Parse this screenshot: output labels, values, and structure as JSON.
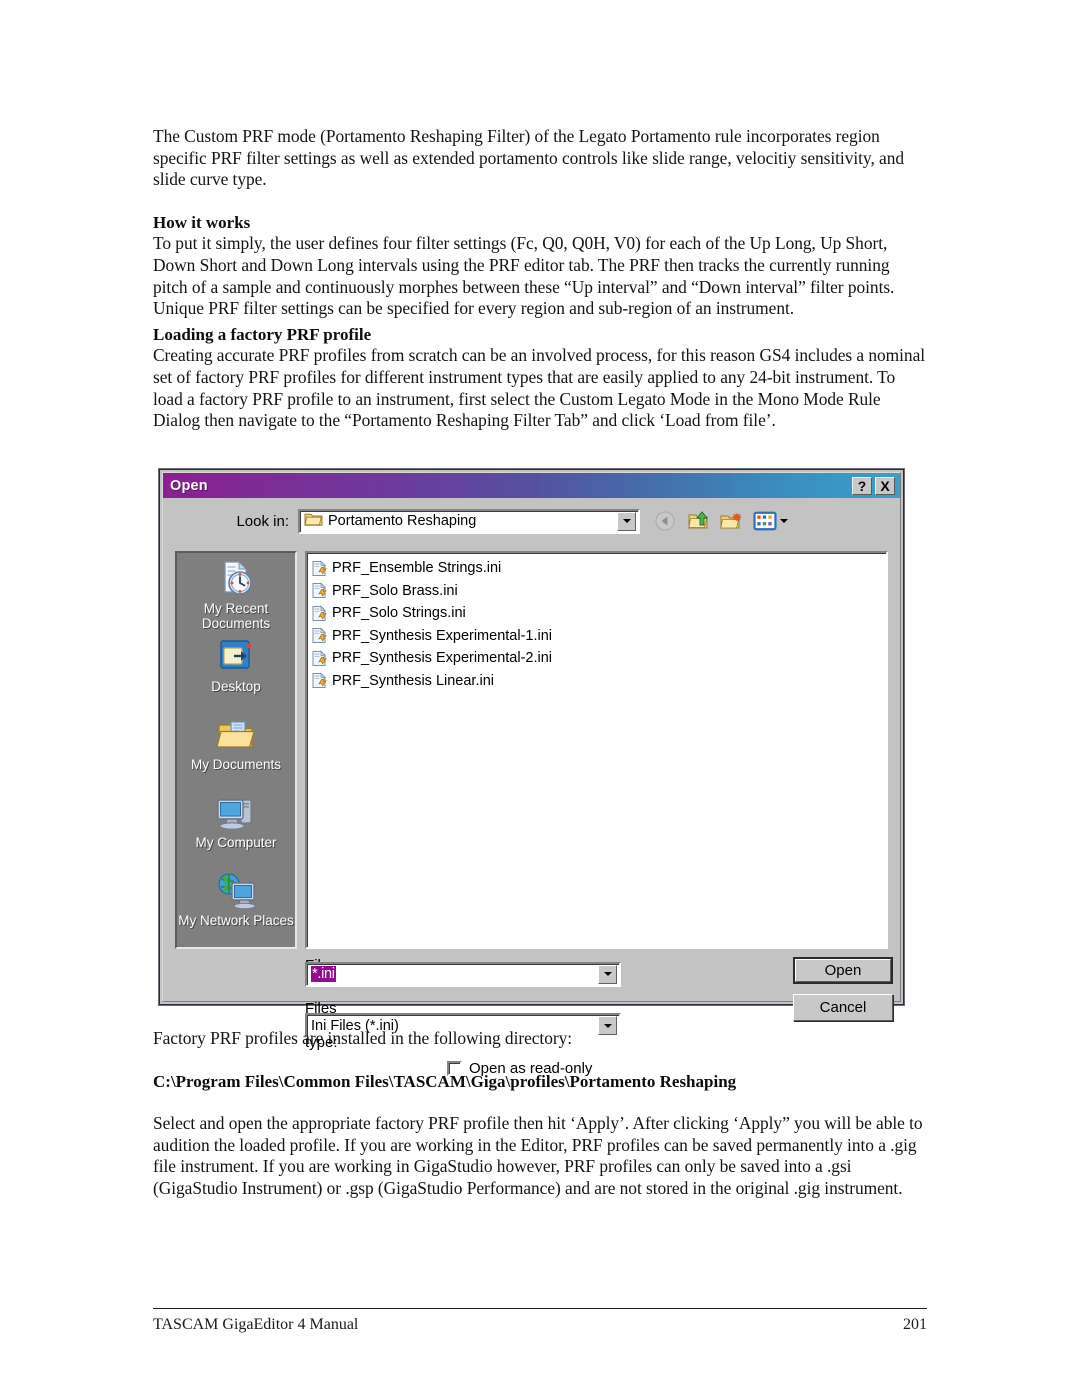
{
  "document": {
    "paragraphs": {
      "intro": "The Custom PRF mode (Portamento Reshaping Filter) of the Legato Portamento rule incorporates region specific PRF filter settings as well as extended portamento controls like slide range, velocitiy sensitivity, and slide curve type.",
      "how_it_works_heading": "How it works",
      "how_it_works_body": "To put it simply, the user defines four filter settings (Fc, Q0, Q0H, V0) for each of the Up Long, Up Short, Down Short and Down Long intervals using the PRF editor tab. The PRF then tracks the currently running pitch of a sample and continuously morphes between these “Up interval” and “Down interval” filter points. Unique PRF filter settings can be specified for every region and sub-region of an instrument.",
      "loading_heading": "Loading a factory PRF profile",
      "loading_body": "Creating accurate PRF profiles from scratch can be an involved process, for this reason GS4 includes a nominal set of factory PRF profiles for different instrument types that are easily applied to any 24-bit instrument. To load a factory PRF profile to an instrument, first select the Custom Legato Mode in the Mono Mode Rule Dialog then navigate to the “Portamento Reshaping Filter Tab” and click ‘Load from file’.",
      "directory_intro": "Factory PRF profiles are installed in the following directory:",
      "directory_path": "C:\\Program Files\\Common Files\\TASCAM\\Giga\\profiles\\Portamento Reshaping",
      "closing_body": "Select and open the appropriate factory PRF profile then hit ‘Apply’. After clicking ‘Apply” you will be able to audition the loaded profile. If you are working in the Editor, PRF profiles can be saved permanently into a .gig file instrument. If you are working in GigaStudio however, PRF profiles can only be saved into a .gsi (GigaStudio Instrument) or .gsp (GigaStudio Performance) and are not stored in the original .gig instrument."
    },
    "footer": {
      "left": "TASCAM GigaEditor 4 Manual",
      "right": "201"
    }
  },
  "dialog": {
    "title": "Open",
    "titlebar_buttons": {
      "help": "?",
      "close": "X"
    },
    "lookin": {
      "label": "Look in:",
      "value": "Portamento Reshaping",
      "icon": "folder-icon"
    },
    "toolbar": [
      {
        "name": "back-icon",
        "title": "Back"
      },
      {
        "name": "up-one-level-icon",
        "title": "Up One Level"
      },
      {
        "name": "new-folder-icon",
        "title": "Create New Folder"
      },
      {
        "name": "views-icon",
        "title": "Views"
      }
    ],
    "places": [
      {
        "label": "My Recent Documents",
        "icon": "recent-documents-icon"
      },
      {
        "label": "Desktop",
        "icon": "desktop-icon"
      },
      {
        "label": "My Documents",
        "icon": "my-documents-icon"
      },
      {
        "label": "My Computer",
        "icon": "my-computer-icon"
      },
      {
        "label": "My Network Places",
        "icon": "network-places-icon"
      }
    ],
    "files": [
      {
        "name": "PRF_Ensemble Strings.ini",
        "icon": "ini-file-icon"
      },
      {
        "name": "PRF_Solo Brass.ini",
        "icon": "ini-file-icon"
      },
      {
        "name": "PRF_Solo Strings.ini",
        "icon": "ini-file-icon"
      },
      {
        "name": "PRF_Synthesis Experimental-1.ini",
        "icon": "ini-file-icon"
      },
      {
        "name": "PRF_Synthesis Experimental-2.ini",
        "icon": "ini-file-icon"
      },
      {
        "name": "PRF_Synthesis Linear.ini",
        "icon": "ini-file-icon"
      }
    ],
    "form": {
      "filename_label": "File name:",
      "filename_value": "*.ini",
      "filetype_label": "Files of type:",
      "filetype_value": "Ini Files (*.ini)",
      "readonly_label": "Open as read-only",
      "readonly_checked": false
    },
    "buttons": {
      "open": "Open",
      "cancel": "Cancel"
    },
    "colors": {
      "titlebar_start": "#8b1f92",
      "titlebar_end": "#3a9fc9",
      "dialog_face": "#c3c3c3",
      "places_bg": "#7f7f7f",
      "selection": "#930a93"
    }
  }
}
